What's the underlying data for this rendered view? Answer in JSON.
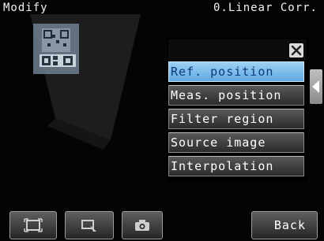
{
  "header": {
    "title": "Modify",
    "mode": "0.Linear Corr."
  },
  "menu": {
    "items": [
      {
        "label": "Ref. position",
        "selected": true
      },
      {
        "label": "Meas. position",
        "selected": false
      },
      {
        "label": "Filter region",
        "selected": false
      },
      {
        "label": "Source image",
        "selected": false
      },
      {
        "label": "Interpolation",
        "selected": false
      }
    ]
  },
  "toolbar": {
    "fit-frame-icon": "fit-frame-icon",
    "zoom-select-icon": "zoom-select-icon",
    "camera-icon": "camera-icon",
    "back_label": "Back"
  },
  "colors": {
    "selected_item": "#6fb6ea",
    "panel": "#000000",
    "button": "#3a3a3a"
  }
}
